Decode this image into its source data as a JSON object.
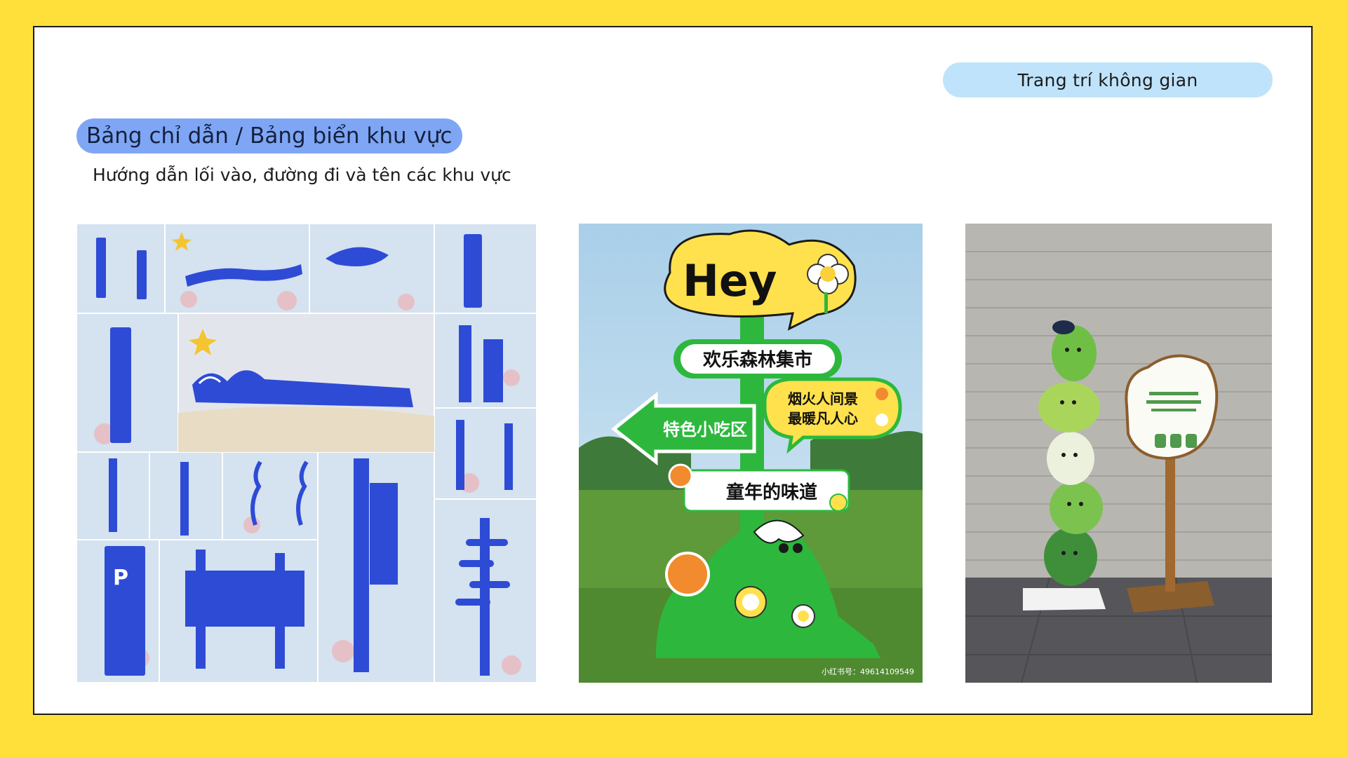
{
  "header": {
    "section_tag": "Trang trí không gian",
    "title": "Bảng chỉ dẫn / Bảng biển khu vực",
    "subtitle": "Hướng dẫn lối vào, đường đi và tên các khu vực"
  },
  "signage_sample": {
    "bubble": "Hey",
    "arrow_1": "欢乐森林集市",
    "arrow_2": "特色小吃区",
    "arrow_3_line1": "烟火人间景",
    "arrow_3_line2": "最暖凡人心",
    "arrow_4": "童年的味道",
    "watermark": "小红书号：49614109549"
  },
  "colors": {
    "page_background": "#FFE03A",
    "tag_pill": "#BFE3FA",
    "title_pill": "#7FA6F5",
    "ocean_blue": "#2E4BD6",
    "sign_green": "#2DB83D",
    "sign_yellow": "#FFE14D"
  }
}
